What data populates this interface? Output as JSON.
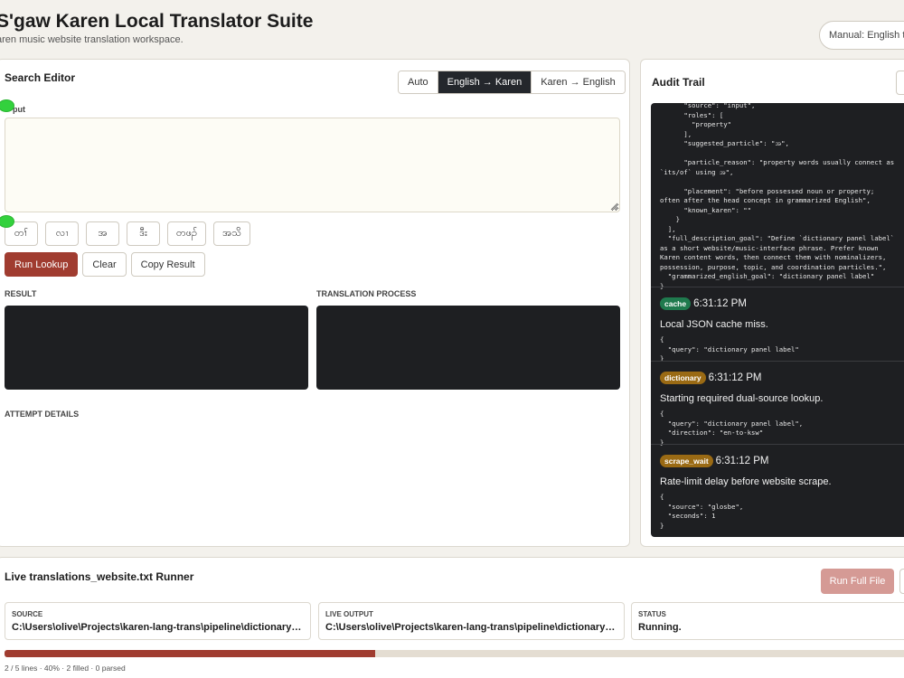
{
  "header": {
    "title": "S'gaw Karen Local Translator Suite",
    "subtitle": "aren music website translation workspace.",
    "mode_selector": "Manual: English t"
  },
  "editor": {
    "title": "Search Editor",
    "direction_tabs": [
      "Auto",
      "English → Karen",
      "Karen → English"
    ],
    "active_direction": "English → Karen",
    "input_label": "put",
    "input_value": "",
    "particles": [
      "တၢ်",
      "လၢ",
      "အ",
      "ဒီး",
      "တဖၣ်",
      "အသိ"
    ],
    "buttons": {
      "run": "Run Lookup",
      "clear": "Clear",
      "copy": "Copy Result"
    },
    "result_label": "RESULT",
    "process_label": "TRANSLATION PROCESS",
    "attempt_label": "ATTEMPT DETAILS"
  },
  "audit": {
    "title": "Audit Trail",
    "top_json": "      \"source\": \"input\",\n      \"roles\": [\n        \"property\"\n      ],\n      \"suggested_particle\": \"အ\",\n\n      \"particle_reason\": \"property words usually connect as\n`its/of` using အ\",\n\n      \"placement\": \"before possessed noun or property;\noften after the head concept in grammarized English\",\n      \"known_karen\": \"\"\n    }\n  ],\n  \"full_description_goal\": \"Define `dictionary panel label`\nas a short website/music-interface phrase. Prefer known\nKaren content words, then connect them with nominalizers,\npossession, purpose, topic, and coordination particles.\",\n  \"grammarized_english_goal\": \"dictionary panel label\"\n}",
    "entries": [
      {
        "badge": "cache",
        "time": "6:31:12 PM",
        "message": "Local JSON cache miss.",
        "detail": "{\n  \"query\": \"dictionary panel label\"\n}"
      },
      {
        "badge": "dictionary",
        "time": "6:31:12 PM",
        "message": "Starting required dual-source lookup.",
        "detail": "{\n  \"query\": \"dictionary panel label\",\n  \"direction\": \"en-to-ksw\"\n}"
      },
      {
        "badge": "scrape_wait",
        "time": "6:31:12 PM",
        "message": "Rate-limit delay before website scrape.",
        "detail": "{\n  \"source\": \"glosbe\",\n  \"seconds\": 1\n}"
      }
    ]
  },
  "runner": {
    "title": "Live translations_website.txt Runner",
    "run_full_label": "Run Full File",
    "source_label": "SOURCE",
    "source_value": "C:\\Users\\olive\\Projects\\karen-lang-trans\\pipeline\\dictionary_panel",
    "output_label": "LIVE OUTPUT",
    "output_value": "C:\\Users\\olive\\Projects\\karen-lang-trans\\pipeline\\dictionary_output",
    "status_label": "STATUS",
    "status_value": "Running.",
    "progress_fraction": 0.4,
    "progress_text": "2 / 5 lines · 40% · 2 filled · 0 parsed"
  },
  "colors": {
    "accent": "#a03c30",
    "dark_panel": "#1e1f22",
    "badge_cache": "#1f7a4e",
    "badge_dictionary": "#9a6a14"
  }
}
